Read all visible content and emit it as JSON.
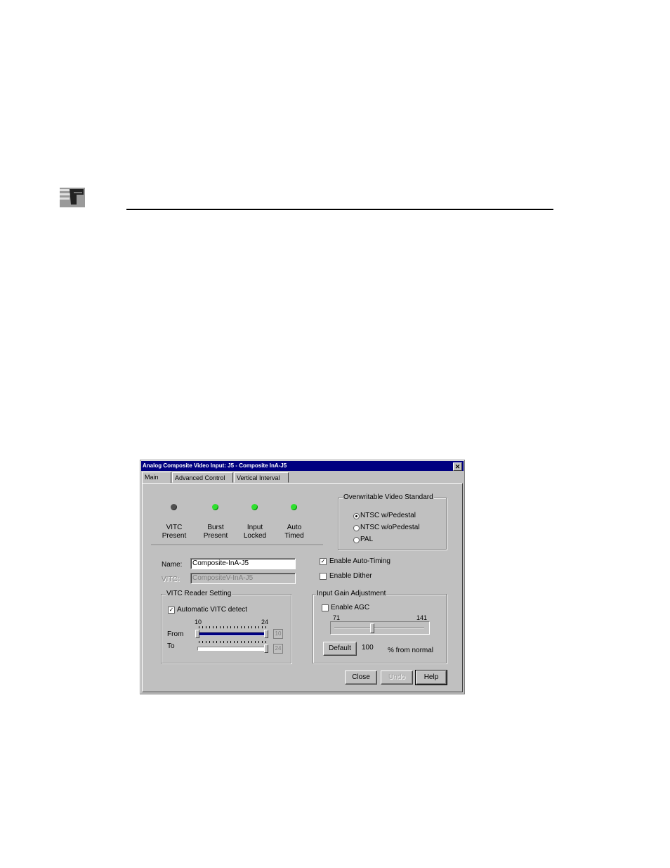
{
  "dialog": {
    "title": "Analog Composite Video Input: J5 - Composite InA-J5",
    "close_glyph": "✕"
  },
  "tabs": [
    {
      "label": "Main",
      "active": true
    },
    {
      "label": "Advanced Control",
      "active": false
    },
    {
      "label": "Vertical Interval",
      "active": false
    }
  ],
  "indicators": [
    {
      "line1": "VITC",
      "line2": "Present",
      "state": "off"
    },
    {
      "line1": "Burst",
      "line2": "Present",
      "state": "on"
    },
    {
      "line1": "Input",
      "line2": "Locked",
      "state": "on"
    },
    {
      "line1": "Auto",
      "line2": "Timed",
      "state": "on"
    }
  ],
  "video_standard": {
    "title": "Overwritable Video Standard",
    "options": [
      "NTSC w/Pedestal",
      "NTSC w/oPedestal",
      "PAL"
    ],
    "selected": "NTSC w/Pedestal"
  },
  "fields": {
    "name_label": "Name:",
    "name_value": "Composite-InA-J5",
    "vitc_label": "VITC:",
    "vitc_value": "CompositeV-InA-J5"
  },
  "options": {
    "auto_timing_label": "Enable Auto-Timing",
    "auto_timing_checked": true,
    "dither_label": "Enable Dither",
    "dither_checked": false
  },
  "vitc_reader": {
    "title": "VITC Reader Setting",
    "auto_detect_label": "Automatic VITC detect",
    "auto_detect_checked": true,
    "scale_min": "10",
    "scale_max": "24",
    "from_label": "From",
    "to_label": "To",
    "from_value": "10",
    "to_value": "24"
  },
  "input_gain": {
    "title": "Input Gain Adjustment",
    "agc_label": "Enable AGC",
    "agc_checked": false,
    "min_label": "71",
    "max_label": "141",
    "value": "100",
    "default_button": "Default",
    "unit": "% from normal"
  },
  "buttons": {
    "close": "Close",
    "undo": "Undo",
    "help": "Help"
  },
  "icons": {
    "logo": "document-logo-icon",
    "checkmark": "✓"
  }
}
